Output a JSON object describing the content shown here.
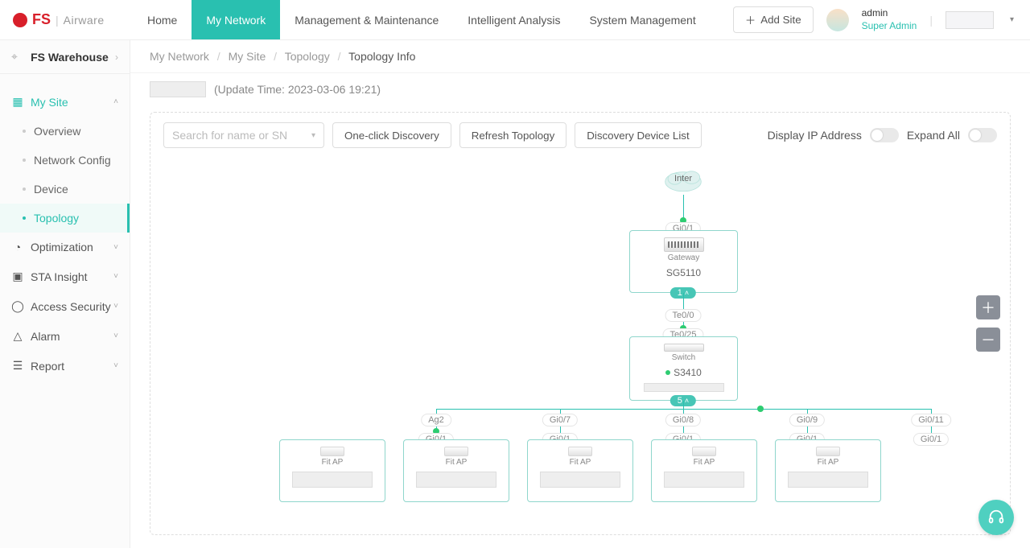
{
  "brand": {
    "fs": "FS",
    "airware": "Airware"
  },
  "nav": {
    "home": "Home",
    "my_network": "My Network",
    "mgmt": "Management & Maintenance",
    "analysis": "Intelligent Analysis",
    "sysmgmt": "System Management"
  },
  "topbar": {
    "add_site": "Add Site",
    "user": "admin",
    "role": "Super Admin"
  },
  "sidebar": {
    "site_label": "FS Warehouse",
    "groups": {
      "my_site": "My Site",
      "optimization": "Optimization",
      "sta_insight": "STA Insight",
      "access_security": "Access Security",
      "alarm": "Alarm",
      "report": "Report"
    },
    "my_site_items": {
      "overview": "Overview",
      "network_config": "Network Config",
      "device": "Device",
      "topology": "Topology"
    }
  },
  "breadcrumbs": {
    "a": "My Network",
    "b": "My Site",
    "c": "Topology",
    "d": "Topology Info"
  },
  "update": "(Update Time: 2023-03-06 19:21)",
  "toolbar": {
    "search_placeholder": "Search for name or SN",
    "one_click": "One-click Discovery",
    "refresh": "Refresh Topology",
    "disc_list": "Discovery Device List",
    "display_ip": "Display IP Address",
    "expand_all": "Expand All"
  },
  "topology": {
    "internet": "Inter",
    "gateway": {
      "type": "Gateway",
      "name": "SG5110",
      "top_port": "Gi0/1",
      "bottom_port": "Te0/0",
      "badge": "1"
    },
    "switch": {
      "type": "Switch",
      "name": "S3410",
      "top_port": "Te0/25",
      "badge": "5"
    },
    "ap_type": "Fit AP",
    "aps": [
      {
        "up": "Ag2",
        "down": "Gi0/1"
      },
      {
        "up": "Gi0/7",
        "down": "Gi0/1"
      },
      {
        "up": "Gi0/8",
        "down": "Gi0/1"
      },
      {
        "up": "Gi0/9",
        "down": "Gi0/1"
      },
      {
        "up": "Gi0/11",
        "down": "Gi0/1"
      }
    ]
  }
}
